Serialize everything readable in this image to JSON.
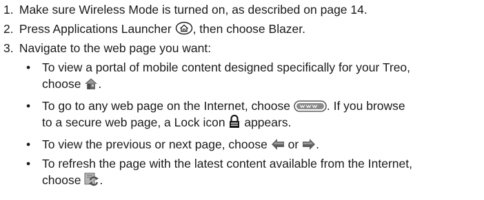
{
  "steps": [
    {
      "num": "1.",
      "text": "Make sure Wireless Mode is turned on, as described on page 14."
    },
    {
      "num": "2.",
      "text_before": "Press Applications Launcher",
      "icon": "applications-launcher-icon",
      "text_after": ", then choose Blazer."
    },
    {
      "num": "3.",
      "text": "Navigate to the web page you want:"
    }
  ],
  "bullets": [
    {
      "dot": "•",
      "line1": "To view a portal of mobile content designed specifically for your Treo,",
      "line2_before": "choose",
      "icon": "home-icon",
      "line2_after": "."
    },
    {
      "dot": "•",
      "line1_before": "To go to any web page on the Internet, choose",
      "icon1": "www-icon",
      "line1_after": ". If you browse",
      "line2_before": "to a secure web page, a Lock icon",
      "icon2": "lock-icon",
      "line2_after": "appears."
    },
    {
      "dot": "•",
      "before": "To view the previous or next page, choose",
      "icon1": "back-arrow-icon",
      "middle": "or",
      "icon2": "forward-arrow-icon",
      "after": "."
    },
    {
      "dot": "•",
      "line1": "To refresh the page with the latest content available from the Internet,",
      "line2_before": "choose",
      "icon": "refresh-icon",
      "line2_after": "."
    }
  ]
}
